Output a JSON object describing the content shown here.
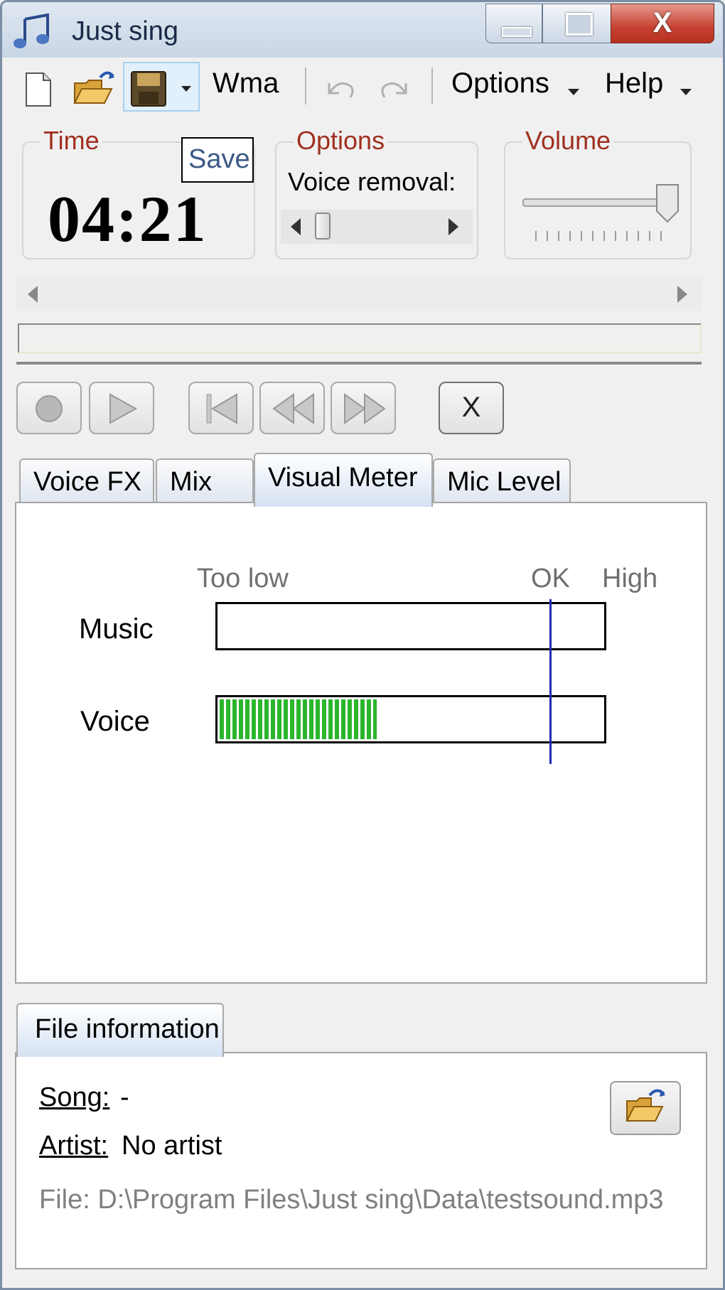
{
  "window": {
    "title": "Just sing",
    "icon": "music-note-icon",
    "controls": [
      "minimize",
      "maximize",
      "close"
    ],
    "close_glyph": "X"
  },
  "toolbar": {
    "icons": [
      "new-file-icon",
      "open-folder-icon",
      "save-disk-icon",
      "dropdown-icon",
      "undo-icon",
      "redo-icon"
    ],
    "format_label": "Wma",
    "options_label": "Options",
    "help_label": "Help",
    "tooltip": "Save"
  },
  "time_group": {
    "label": "Time",
    "value": "04:21"
  },
  "options_group": {
    "label": "Options",
    "voice_removal_label": "Voice removal:",
    "voice_removal_level": 0.0
  },
  "volume_group": {
    "label": "Volume",
    "level": 1.0
  },
  "transport": {
    "icons": [
      "record-icon",
      "play-icon",
      "skip-start-icon",
      "rewind-icon",
      "fast-forward-icon",
      "stop-icon"
    ],
    "stop_glyph": "X"
  },
  "tabs": [
    {
      "label": "Voice FX",
      "active": false
    },
    {
      "label": "Mix",
      "active": false
    },
    {
      "label": "Visual Meter",
      "active": true
    },
    {
      "label": "Mic Level",
      "active": false
    }
  ],
  "visual_meter": {
    "scale": {
      "low": "Too low",
      "ok": "OK",
      "high": "High"
    },
    "rows": [
      {
        "label": "Music",
        "level": 0.0
      },
      {
        "label": "Voice",
        "level": 0.41
      }
    ],
    "level_color": "#2bb52b",
    "ok_line_color": "#1f2db0"
  },
  "file_info": {
    "tab_label": "File information",
    "song_label": "Song:",
    "song_value": "-",
    "artist_label": "Artist:",
    "artist_value": "No artist",
    "file_path": "File: D:\\Program Files\\Just sing\\Data\\testsound.mp3",
    "open_icon": "open-folder-icon"
  }
}
